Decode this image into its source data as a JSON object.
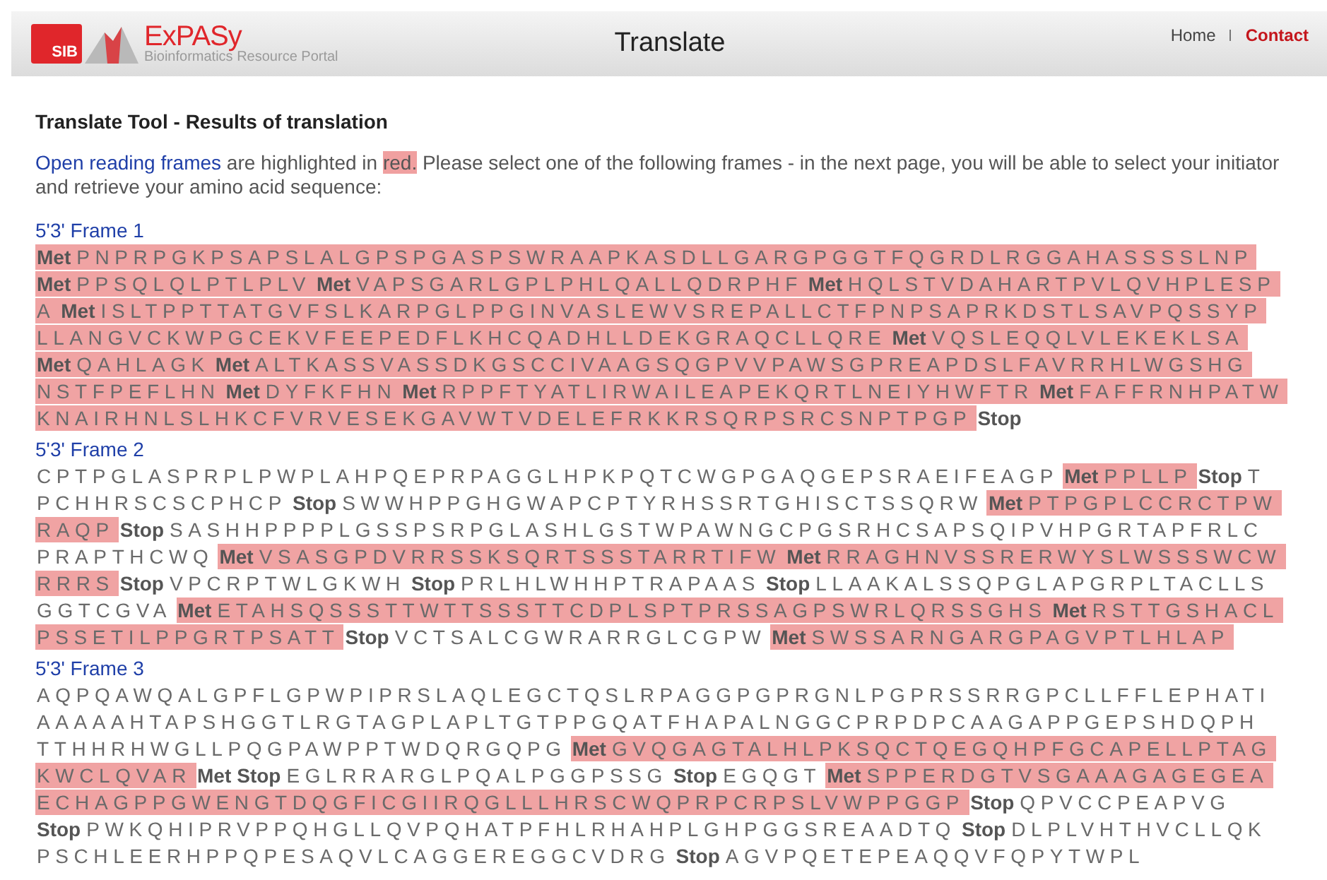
{
  "header": {
    "logo": {
      "badge": "SIB",
      "name": "ExPASy",
      "tagline": "Bioinformatics Resource Portal"
    },
    "title": "Translate",
    "nav": [
      {
        "label": "Home",
        "selected": false
      },
      {
        "label": "Contact",
        "selected": true
      }
    ]
  },
  "heading": "Translate Tool - Results of translation",
  "intro": {
    "link": "Open reading frames",
    "before": " are highlighted in ",
    "highlight": "red.",
    "after": " Please select one of the following frames - in the next page, you will be able to select your initiator and retrieve your amino acid sequence:"
  },
  "frames": [
    {
      "title": "5'3' Frame 1",
      "lines": [
        {
          "segments": [
            {
              "kind": "met",
              "text": "Met",
              "orf": true
            },
            {
              "kind": "residues",
              "text": "PNPRPGKPSAPSLALGPSPGASPSWRAAPKASDLLGARGPGGTFQGRDLRGGAHASSSSLNP",
              "orf": true
            }
          ]
        },
        {
          "segments": [
            {
              "kind": "met",
              "text": "Met",
              "orf": true
            },
            {
              "kind": "residues",
              "text": "PPSQLQLPTLPLV",
              "orf": true
            },
            {
              "kind": "met",
              "text": "Met",
              "orf": true
            },
            {
              "kind": "residues",
              "text": "VAPSGARLGPLPHLQALLQDRPHF",
              "orf": true
            },
            {
              "kind": "met",
              "text": "Met",
              "orf": true
            },
            {
              "kind": "residues",
              "text": "HQLSTVDAHARTPVLQVHPLESP",
              "orf": true
            }
          ]
        },
        {
          "segments": [
            {
              "kind": "residues",
              "text": "A",
              "orf": true
            },
            {
              "kind": "met",
              "text": "Met",
              "orf": true
            },
            {
              "kind": "residues",
              "text": "ISLTPPTTATGVFSLKARPGLPPGINVASLEWVSREPALLCTFPNPSAPRKDSTLSAVPQSSYP",
              "orf": true
            }
          ]
        },
        {
          "segments": [
            {
              "kind": "residues",
              "text": "LLANGVCKWPGCEKVFEEPEDFLKHCQADHLLDEKGRAQCLLQRE",
              "orf": true
            },
            {
              "kind": "met",
              "text": "Met",
              "orf": true
            },
            {
              "kind": "residues",
              "text": "VQSLEQQLVLEKEKLSA",
              "orf": true
            }
          ]
        },
        {
          "segments": [
            {
              "kind": "met",
              "text": "Met",
              "orf": true
            },
            {
              "kind": "residues",
              "text": "QAHLAGK",
              "orf": true
            },
            {
              "kind": "met",
              "text": "Met",
              "orf": true
            },
            {
              "kind": "residues",
              "text": "ALTKASSVASSDKGSCCIVAAGSQGPVVPAWSGPREAPDSLFAVRRHLWGSHG",
              "orf": true
            }
          ]
        },
        {
          "segments": [
            {
              "kind": "residues",
              "text": "NSTFPEFLHN",
              "orf": true
            },
            {
              "kind": "met",
              "text": "Met",
              "orf": true
            },
            {
              "kind": "residues",
              "text": "DYFKFHN",
              "orf": true
            },
            {
              "kind": "met",
              "text": "Met",
              "orf": true
            },
            {
              "kind": "residues",
              "text": "RPPFTYATLIRWAILEAPEKQRTLNEIYHWFTR",
              "orf": true
            },
            {
              "kind": "met",
              "text": "Met",
              "orf": true
            },
            {
              "kind": "residues",
              "text": "FAFFRNHPATW",
              "orf": true
            }
          ]
        },
        {
          "segments": [
            {
              "kind": "residues",
              "text": "KNAIRHNLSLHKCFVRVESEKGAVWTVDELEFRKKRSQRPSRCSNPTPGP",
              "orf": true
            },
            {
              "kind": "stop",
              "text": "Stop",
              "orf": false
            }
          ]
        }
      ]
    },
    {
      "title": "5'3' Frame 2",
      "lines": [
        {
          "segments": [
            {
              "kind": "residues",
              "text": "CPTPGLASPRPLPWPLAHPQEPRPAGGLHPKPQTCWGPGAQGEPSRAEIFEAGP",
              "orf": false
            },
            {
              "kind": "met",
              "text": "Met",
              "orf": true
            },
            {
              "kind": "residues",
              "text": "PPLLP",
              "orf": true
            },
            {
              "kind": "stop",
              "text": "Stop",
              "orf": false
            },
            {
              "kind": "residues",
              "text": "T",
              "orf": false
            }
          ]
        },
        {
          "segments": [
            {
              "kind": "residues",
              "text": "PCHHRSCSCPHCP",
              "orf": false
            },
            {
              "kind": "stop",
              "text": "Stop",
              "orf": false
            },
            {
              "kind": "residues",
              "text": "SWWHPPGHGWAPCPTYRHSSRTGHISCTSSQRW",
              "orf": false
            },
            {
              "kind": "met",
              "text": "Met",
              "orf": true
            },
            {
              "kind": "residues",
              "text": "PTPGPLCCRCTPW",
              "orf": true
            }
          ]
        },
        {
          "segments": [
            {
              "kind": "residues",
              "text": "RAQP",
              "orf": true
            },
            {
              "kind": "stop",
              "text": "Stop",
              "orf": false
            },
            {
              "kind": "residues",
              "text": "SASHHPPPPLGSSPSRPGLASHLGSTWPAWNGCPGSRHCSAPSQIPVHPGRTAPFRLC",
              "orf": false
            }
          ]
        },
        {
          "segments": [
            {
              "kind": "residues",
              "text": "PRAPTHCWQ",
              "orf": false
            },
            {
              "kind": "met",
              "text": "Met",
              "orf": true
            },
            {
              "kind": "residues",
              "text": "VSASGPDVRRSSKSQRTSSSTARRTIFW",
              "orf": true
            },
            {
              "kind": "met",
              "text": "Met",
              "orf": true
            },
            {
              "kind": "residues",
              "text": "RRAGHNVSSRERWYSLWSSSWCW",
              "orf": true
            }
          ]
        },
        {
          "segments": [
            {
              "kind": "residues",
              "text": "RRRS",
              "orf": true
            },
            {
              "kind": "stop",
              "text": "Stop",
              "orf": false
            },
            {
              "kind": "residues",
              "text": "VPCRPTWLGKWH",
              "orf": false
            },
            {
              "kind": "stop",
              "text": "Stop",
              "orf": false
            },
            {
              "kind": "residues",
              "text": "PRLHLWHHPTRAPAAS",
              "orf": false
            },
            {
              "kind": "stop",
              "text": "Stop",
              "orf": false
            },
            {
              "kind": "residues",
              "text": "LLAAKALSSQPGLAPGRPLTACLLS",
              "orf": false
            }
          ]
        },
        {
          "segments": [
            {
              "kind": "residues",
              "text": "GGTCGVA",
              "orf": false
            },
            {
              "kind": "met",
              "text": "Met",
              "orf": true
            },
            {
              "kind": "residues",
              "text": "ETAHSQSSSTTWTTSSSTTCDPLSPTPRSSAGPSWRLQRSSGHS",
              "orf": true
            },
            {
              "kind": "met",
              "text": "Met",
              "orf": true
            },
            {
              "kind": "residues",
              "text": "RSTTGSHACL",
              "orf": true
            }
          ]
        },
        {
          "segments": [
            {
              "kind": "residues",
              "text": "PSSETILPPGRTPSATT",
              "orf": true
            },
            {
              "kind": "stop",
              "text": "Stop",
              "orf": false
            },
            {
              "kind": "residues",
              "text": "VCTSALCGWRARRGLCGPW",
              "orf": false
            },
            {
              "kind": "met",
              "text": "Met",
              "orf": true
            },
            {
              "kind": "residues",
              "text": "SWSSARNGARGPAGVPTLHLAP",
              "orf": true
            }
          ]
        }
      ]
    },
    {
      "title": "5'3' Frame 3",
      "lines": [
        {
          "segments": [
            {
              "kind": "residues",
              "text": "AQPQAWQALGPFLGPWPIPRSLAQLEGCTQSLRPAGGPGPRGNLPGPRSSRRGPCLLFFLEPHATI",
              "orf": false
            }
          ]
        },
        {
          "segments": [
            {
              "kind": "residues",
              "text": "AAAAAHTAPSHGGTLRGTAGPLAPLTGTPPGQATFHAPALNGGCPRPDPCAAGAPPGEPSHDQPH",
              "orf": false
            }
          ]
        },
        {
          "segments": [
            {
              "kind": "residues",
              "text": "TTHHRHWGLLPQGPAWPPTWDQRGQPG",
              "orf": false
            },
            {
              "kind": "met",
              "text": "Met",
              "orf": true
            },
            {
              "kind": "residues",
              "text": "GVQGAGTALHLPKSQCTQEGQHPFGCAPELLPTAG",
              "orf": true
            }
          ]
        },
        {
          "segments": [
            {
              "kind": "residues",
              "text": "KWCLQVAR",
              "orf": true
            },
            {
              "kind": "met",
              "text": "Met",
              "orf": false
            },
            {
              "kind": "stop",
              "text": "Stop",
              "orf": false
            },
            {
              "kind": "residues",
              "text": "EGLRRARGLPQALPGGPSSG",
              "orf": false
            },
            {
              "kind": "stop",
              "text": "Stop",
              "orf": false
            },
            {
              "kind": "residues",
              "text": "EGQGT",
              "orf": false
            },
            {
              "kind": "met",
              "text": "Met",
              "orf": true
            },
            {
              "kind": "residues",
              "text": "SPPERDGTVSGAAAGAGEGEA",
              "orf": true
            }
          ]
        },
        {
          "segments": [
            {
              "kind": "residues",
              "text": "ECHAGPPGWENGTDQGFICGIIRQGLLLHRSCWQPRPCRPSLVWPPGGP",
              "orf": true
            },
            {
              "kind": "stop",
              "text": "Stop",
              "orf": false
            },
            {
              "kind": "residues",
              "text": "QPVCCPEAPVG",
              "orf": false
            }
          ]
        },
        {
          "segments": [
            {
              "kind": "stop",
              "text": "Stop",
              "orf": false
            },
            {
              "kind": "residues",
              "text": "PWKQHIPRVPPQHGLLQVPQHATPFHLRHAHPLGHPGGSREAADTQ",
              "orf": false
            },
            {
              "kind": "stop",
              "text": "Stop",
              "orf": false
            },
            {
              "kind": "residues",
              "text": "DLPLVHTHVCLLQK",
              "orf": false
            }
          ]
        },
        {
          "segments": [
            {
              "kind": "residues",
              "text": "PSCHLEERHPPQPESAQVLCAGGEREGGCVDRG",
              "orf": false
            },
            {
              "kind": "stop",
              "text": "Stop",
              "orf": false
            },
            {
              "kind": "residues",
              "text": "AGVPQETEPEAQQVFQPYTWPL",
              "orf": false
            }
          ]
        }
      ]
    }
  ]
}
